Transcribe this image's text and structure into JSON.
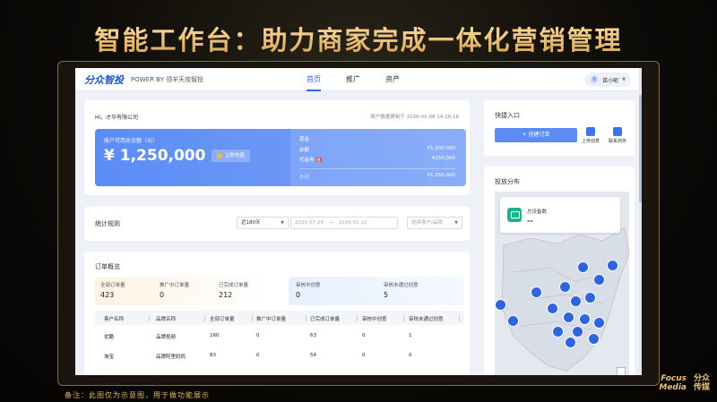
{
  "banner": {
    "title": "智能工作台：助力商家完成一体化营销管理"
  },
  "header": {
    "logo": "分众智投",
    "power": "POWER BY 领羊天攻智投",
    "tabs": [
      {
        "label": "首页",
        "active": true
      },
      {
        "label": "推广",
        "active": false
      },
      {
        "label": "资产",
        "active": false
      }
    ],
    "user": {
      "avatar": "苗",
      "name": "苗小昵"
    }
  },
  "account": {
    "greeting": "Hi，才华有限公司",
    "updated": "账户数据更新于 2026-01-08 14:20:18",
    "balance_title": "账户可用总余额（元）",
    "balance_value": "¥ 1,250,000",
    "recharge_label": "立即充值",
    "breakdown": {
      "cash_label": "现金",
      "rows": [
        {
          "label": "余额",
          "value": "¥1,000,000"
        },
        {
          "label": "代金券",
          "tag": "卷",
          "value": "¥250,000"
        }
      ],
      "subtotal_label": "小计",
      "subtotal_value": "¥1,250,000"
    }
  },
  "stats": {
    "label": "统计规则",
    "range": "近180天",
    "date_from": "2025-07-29",
    "date_sep": "→",
    "date_to": "2026-01-22",
    "client_placeholder": "选择客户/品牌"
  },
  "orders": {
    "title": "订单概览",
    "kpis": [
      {
        "label": "全部订单量",
        "value": "423"
      },
      {
        "label": "推广中订单量",
        "value": "0"
      },
      {
        "label": "已完成订单量",
        "value": "212"
      },
      {
        "label": "审核中创意",
        "value": "0"
      },
      {
        "label": "审核未通过创意",
        "value": "5"
      }
    ],
    "columns": [
      "客户名称",
      "品牌名称",
      "全部订单量",
      "推广中订单量",
      "已完成订单量",
      "审核中创意",
      "审核未通过创意"
    ],
    "rows": [
      [
        "优酷",
        "品牌视频",
        "160",
        "0",
        "63",
        "0",
        "1"
      ],
      [
        "淘宝",
        "品牌阿里妈妈",
        "83",
        "0",
        "54",
        "0",
        "0"
      ]
    ]
  },
  "quick": {
    "title": "快捷入口",
    "create_label": "+ 创建订单",
    "upload_label": "上传创意",
    "contact_label": "联系商务"
  },
  "map": {
    "title": "投放分布",
    "device_label": "总设备数",
    "device_value": "--"
  },
  "footer": {
    "note": "备注：此图仅为示意图，用于做功能展示",
    "brand_en": "Focus Media",
    "brand_cn": "分众传媒"
  },
  "colors": {
    "accent": "#2f6bf0",
    "banner_gold": "#f0c67a",
    "map_dot": "#2f64e0"
  }
}
